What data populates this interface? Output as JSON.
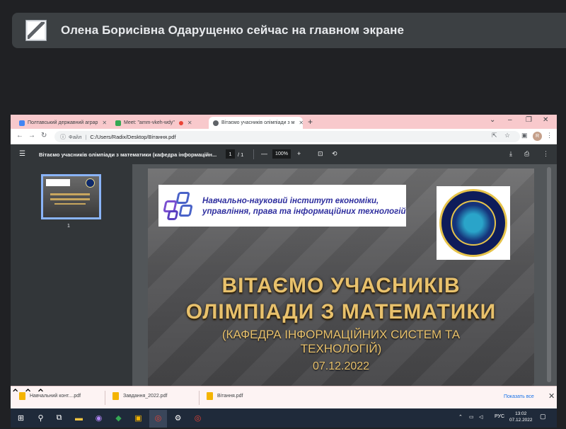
{
  "meet": {
    "banner_text": "Олена Борисівна Одарущенко сейчас на главном экране"
  },
  "browser": {
    "tabs": [
      {
        "label": "Полтавський державний аграр",
        "color": "#4285f4"
      },
      {
        "label": "Meet: \"amm-vkeh-wdy\"",
        "color": "#34a853"
      },
      {
        "label": "Вітаємо учасників олімпіади з м",
        "color": "#5f6368"
      }
    ],
    "new_tab": "+",
    "window_controls": {
      "minimize": "–",
      "maximize": "❐",
      "close": "✕",
      "expand": "⌄"
    },
    "address": {
      "scheme": "Файл",
      "path": "C:/Users/Radix/Desktop/Вітання.pdf"
    },
    "avatar": "R"
  },
  "pdf": {
    "title": "Вітаємо учасників олімпіади з математики (кафедра інформаційн...",
    "page_current": "1",
    "page_total": "/  1",
    "zoom_out": "—",
    "zoom": "100%",
    "zoom_in": "+",
    "thumbnail_label": "1"
  },
  "slide": {
    "institute_line1": "Навчально-науковий інститут економіки,",
    "institute_line2": "управління, права та інформаційних технологій",
    "title_line1": "ВІТАЄМО УЧАСНИКІВ",
    "title_line2": "ОЛІМПІАДИ З МАТЕМАТИКИ",
    "subtitle_line1": "(КАФЕДРА ІНФОРМАЦІЙНИХ СИСТЕМ ТА",
    "subtitle_line2": "ТЕХНОЛОГІЙ)",
    "date": "07.12.2022"
  },
  "downloads": {
    "items": [
      "Навчальний конт....pdf",
      "Завдання_2022.pdf",
      "Вітання.pdf"
    ],
    "show_all": "Показать все"
  },
  "taskbar": {
    "lang": "РУС",
    "time": "13:02",
    "date": "07.12.2022"
  }
}
